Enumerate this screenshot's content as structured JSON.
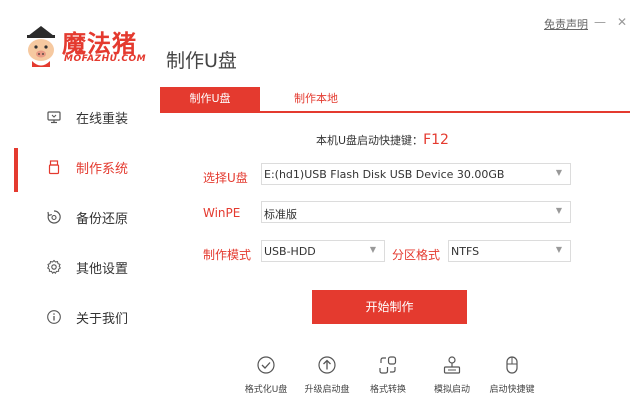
{
  "header": {
    "logo_cn": "魔法猪",
    "logo_en": "MOFAZHU.COM",
    "title": "制作U盘",
    "disclaimer": "免责声明",
    "minimize": "—",
    "close": "✕"
  },
  "sidebar": {
    "items": [
      {
        "label": "在线重装",
        "icon": "monitor-icon"
      },
      {
        "label": "制作系统",
        "icon": "usb-drive-icon"
      },
      {
        "label": "备份还原",
        "icon": "backup-icon"
      },
      {
        "label": "其他设置",
        "icon": "gear-icon"
      },
      {
        "label": "关于我们",
        "icon": "info-icon"
      }
    ],
    "active_index": 1
  },
  "tabs": [
    {
      "label": "制作U盘",
      "active": true
    },
    {
      "label": "制作本地",
      "active": false
    }
  ],
  "hotkey": {
    "label": "本机U盘启动快捷键：",
    "key": "F12"
  },
  "form": {
    "usb_label": "选择U盘",
    "usb_value": "E:(hd1)USB Flash Disk USB Device 30.00GB",
    "winpe_label": "WinPE",
    "winpe_value": "标准版",
    "mode_label": "制作模式",
    "mode_value": "USB-HDD",
    "partition_label": "分区格式",
    "partition_value": "NTFS"
  },
  "start_button": "开始制作",
  "tools": [
    {
      "label": "格式化U盘",
      "icon": "check-circle-icon"
    },
    {
      "label": "升级启动盘",
      "icon": "upload-circle-icon"
    },
    {
      "label": "格式转换",
      "icon": "convert-icon"
    },
    {
      "label": "模拟启动",
      "icon": "simulate-icon"
    },
    {
      "label": "启动快捷键",
      "icon": "mouse-icon"
    }
  ],
  "colors": {
    "accent": "#e43a2f"
  }
}
